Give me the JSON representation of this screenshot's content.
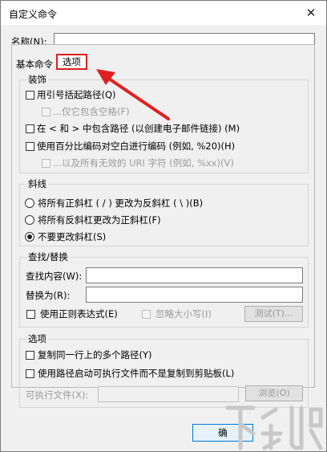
{
  "window": {
    "title": "自定义命令",
    "close_glyph": "✕"
  },
  "name_field": {
    "label": "名称(N):",
    "value": ""
  },
  "tabs": [
    {
      "label": "基本命令"
    },
    {
      "label": "选项"
    }
  ],
  "decoration": {
    "legend": "装饰",
    "opt1": "用引号括起路径(Q)",
    "opt1_sub": "...仅它包含空格(F)",
    "opt2": "在 < 和 > 中包含路径 (以创建电子邮件链接) (M)",
    "opt3": "使用百分比编码对空白进行编码 (例如, %20)(H)",
    "opt3_sub": "...以及所有无效的 URI 字符 (例如, %xx)(V)"
  },
  "slash": {
    "legend": "斜线",
    "r1": "将所有正斜杠 ( / ) 更改为反斜杠 ( \\ )(B)",
    "r2": "将所有反斜杠更改为正斜杠(F)",
    "r3": "不要更改斜杠(S)",
    "selected": "r3"
  },
  "findreplace": {
    "legend": "查找/替换",
    "find_label": "查找内容(W):",
    "replace_label": "替换为(R):",
    "regex_label": "使用正则表达式(E)",
    "ignore_case_label": "忽略大小写(I)",
    "test_button": "测试(T)..."
  },
  "options": {
    "legend": "选项",
    "o1": "复制同一行上的多个路径(Y)",
    "o2": "使用路径启动可执行文件而不是复制到剪贴板(L)",
    "exe_label": "可执行文件(X):",
    "browse_button": "浏览(O)"
  },
  "ok_button": "确",
  "colors": {
    "highlight": "#e02020",
    "accent": "#0078d7"
  },
  "watermark": "下载吧"
}
